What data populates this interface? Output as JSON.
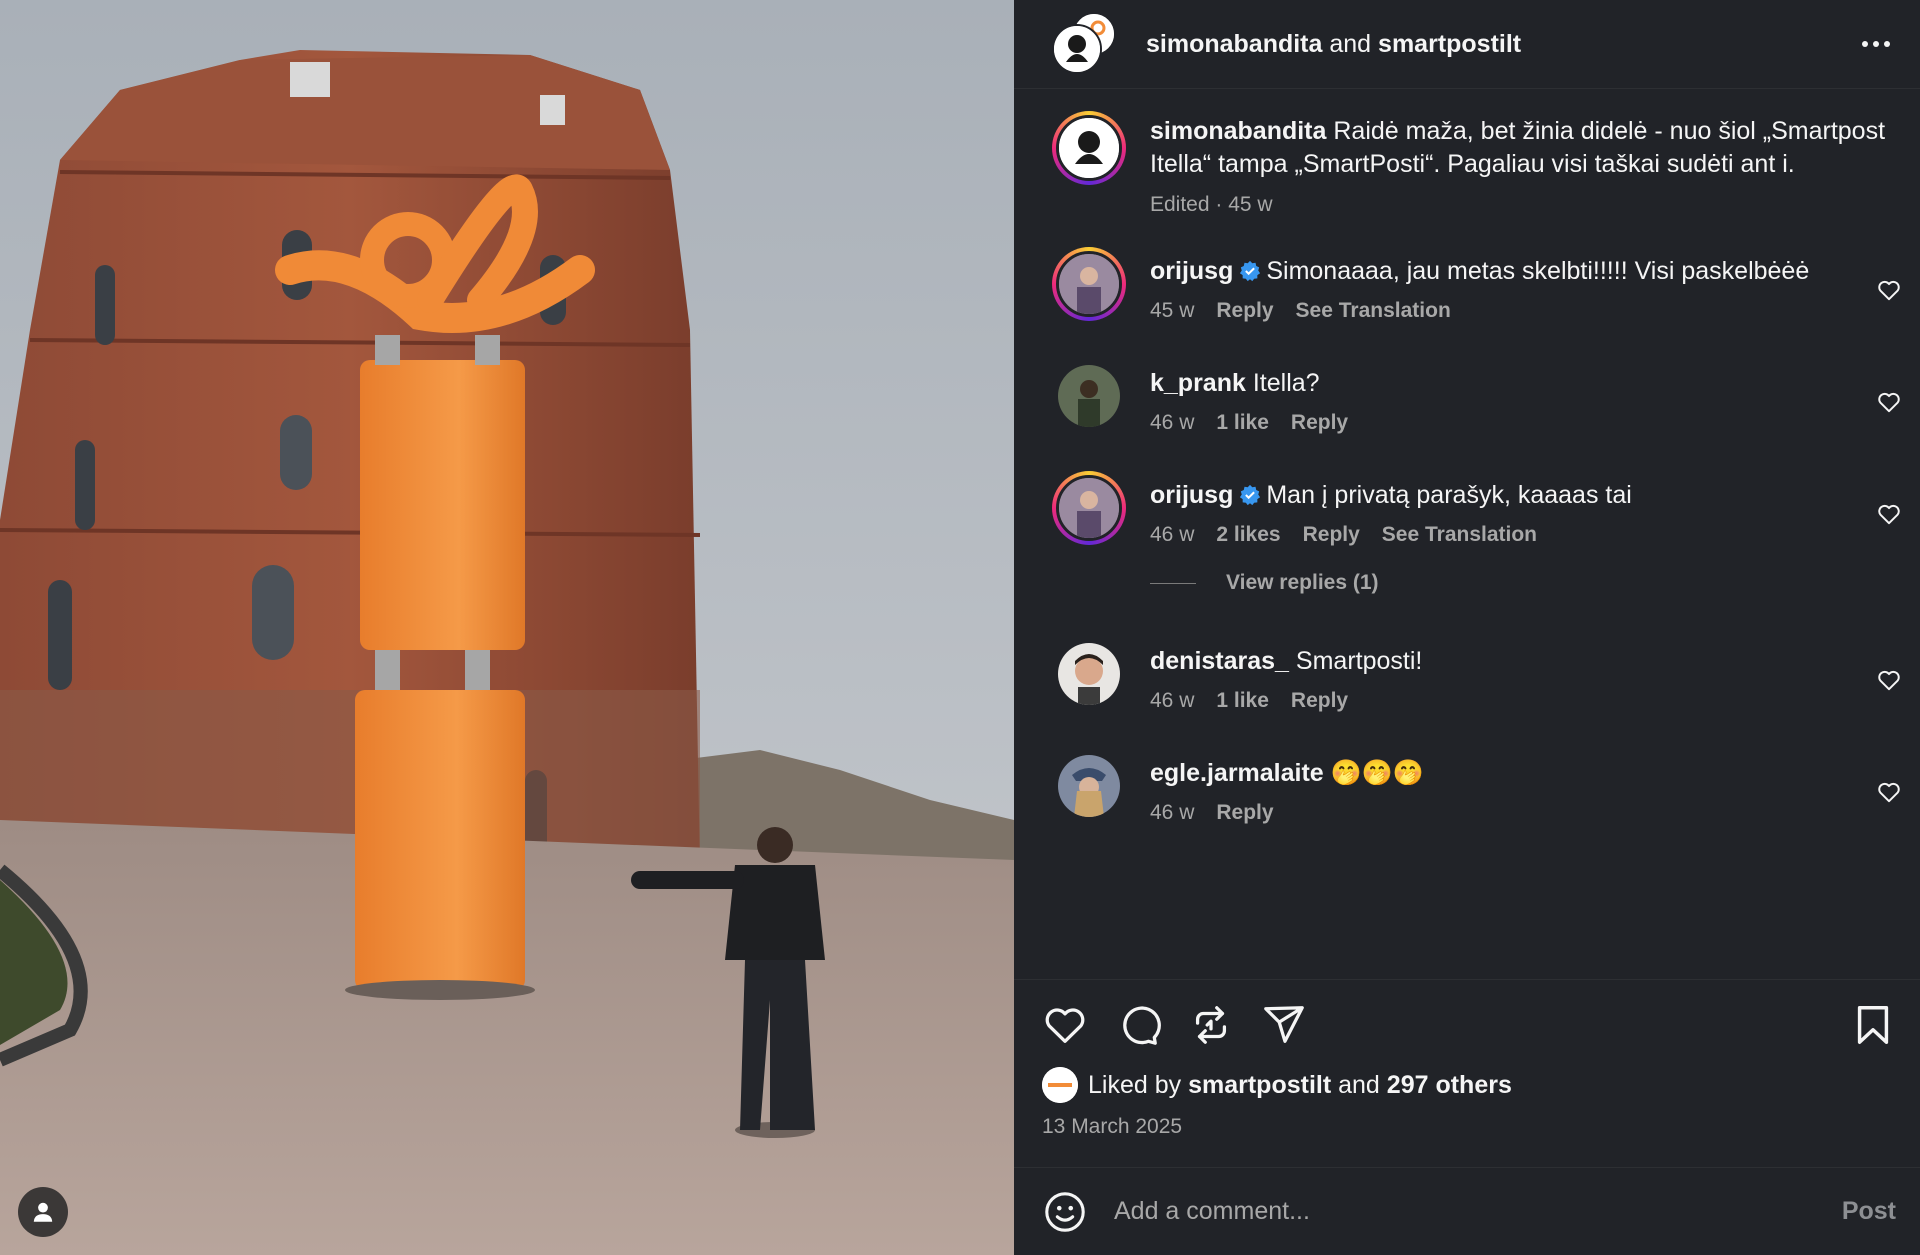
{
  "header": {
    "user1": "simonabandita",
    "and": "and",
    "user2": "smartpostilt"
  },
  "caption": {
    "user": "simonabandita",
    "text": "Raidė maža, bet žinia didelė - nuo šiol „Smartpost Itella“ tampa „SmartPosti“. Pagaliau visi taškai sudėti ant i.",
    "edited": "Edited · 45 w"
  },
  "comments": [
    {
      "user": "orijusg",
      "text": "Simonaaaa, jau metas skelbti!!!!! Visi paskelbėėė",
      "age": "45 w",
      "reply": "Reply",
      "translate": "See Translation"
    },
    {
      "user": "k_prank",
      "text": "Itella?",
      "age": "46 w",
      "likes": "1 like",
      "reply": "Reply"
    },
    {
      "user": "orijusg",
      "text": "Man į privatą parašyk, kaaaas tai",
      "age": "46 w",
      "likes": "2 likes",
      "reply": "Reply",
      "translate": "See Translation"
    },
    {
      "user": "denistaras_",
      "text": "Smartposti!",
      "age": "46 w",
      "likes": "1 like",
      "reply": "Reply"
    },
    {
      "user": "egle.jarmalaite",
      "text": "🤭🤭🤭",
      "age": "46 w",
      "reply": "Reply"
    }
  ],
  "view_replies": "View replies (1)",
  "likes": {
    "prefix": "Liked by",
    "user": "smartpostilt",
    "and": "and",
    "others": "297 others"
  },
  "date": "13 March 2025",
  "composer": {
    "placeholder": "Add a comment...",
    "post_label": "Post"
  },
  "icons": {
    "more": "more-horizontal-icon",
    "like": "heart-icon",
    "comment": "comment-icon",
    "repost": "repost-icon",
    "share": "paper-plane-icon",
    "save": "bookmark-icon",
    "emoji": "emoji-icon",
    "tag": "user-tag-icon"
  },
  "colors": {
    "panel_bg": "#212328",
    "text": "#f5f5f5",
    "muted": "#a8a8a8",
    "brand_orange": "#f28c38",
    "verified_blue": "#3897f0"
  }
}
